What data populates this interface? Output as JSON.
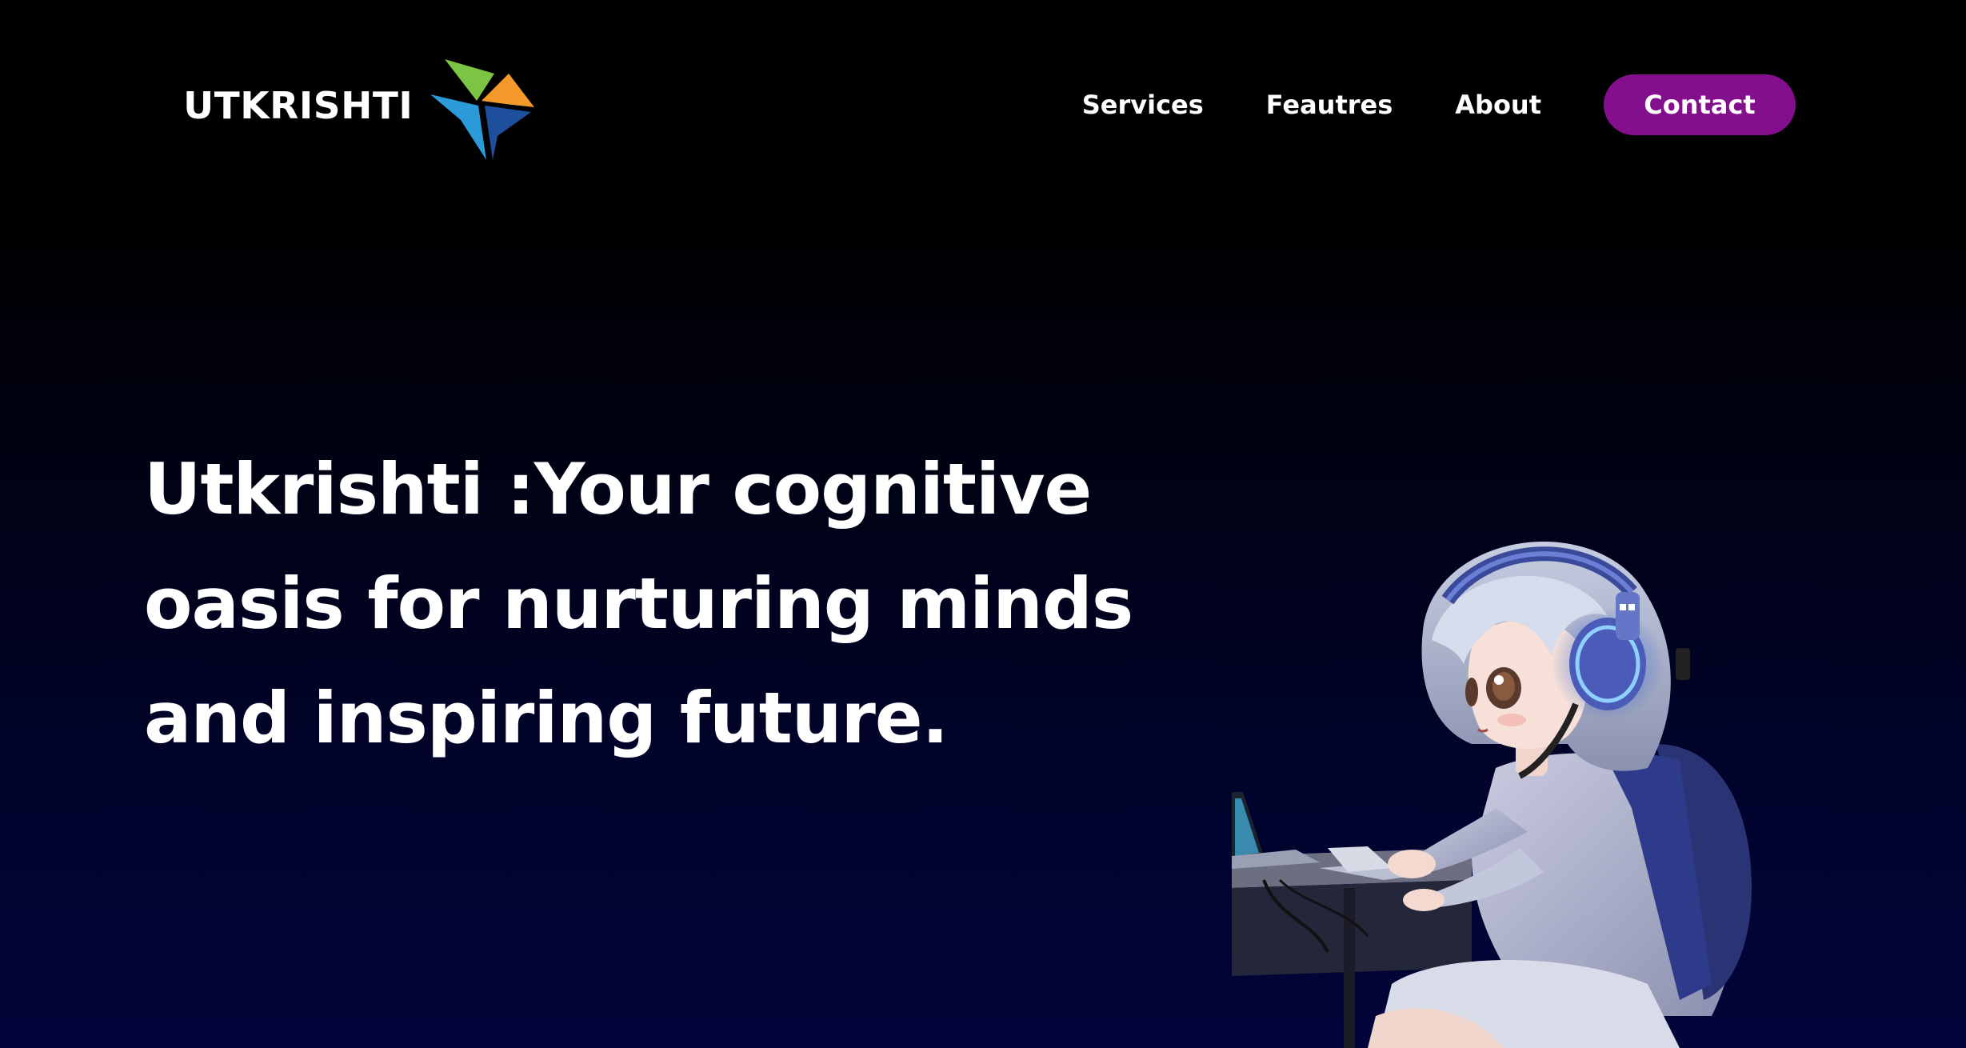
{
  "brand": {
    "name": "UTKRISHTI",
    "logo_icon": "star-logo-icon",
    "logo_colors": [
      "#7cc443",
      "#f39a2b",
      "#1e4f9c",
      "#2a9ad9"
    ]
  },
  "nav": {
    "links": [
      "Services",
      "Feautres",
      "About"
    ],
    "contact_label": "Contact"
  },
  "hero": {
    "headline": "Utkrishti :Your cognitive oasis for nurturing minds and inspiring future.",
    "illustration_icon": "girl-at-laptop-illustration"
  },
  "colors": {
    "accent": "#840f8c",
    "background_top": "#000000",
    "background_bottom": "#02043a",
    "text": "#ffffff"
  }
}
